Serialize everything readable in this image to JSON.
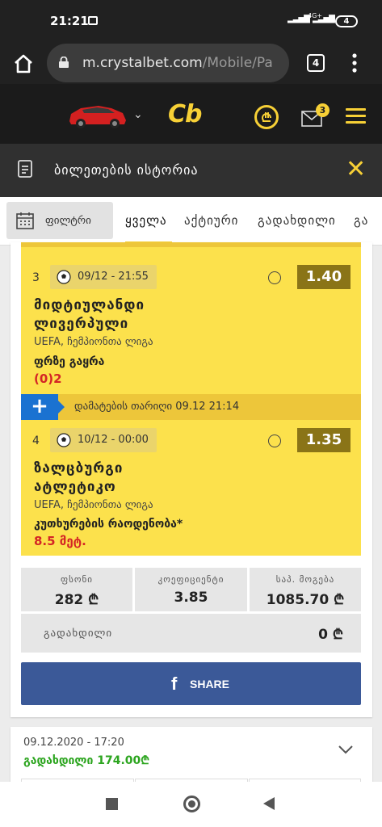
{
  "status_bar": {
    "time": "21:21",
    "network": "4G+",
    "battery": "4"
  },
  "browser": {
    "url_main": "m.crystalbet.com",
    "url_path": "/Mobile/Pa",
    "tab_count": "4"
  },
  "site_header": {
    "logo": "Cb",
    "mail_badge": "3"
  },
  "history_bar": {
    "title": "ბილეთების ისტორია"
  },
  "tabs": {
    "filter_label": "ფილტრი",
    "items": [
      "ყველა",
      "აქტიური",
      "გადახდილი",
      "გა"
    ]
  },
  "ticket": {
    "events": [
      {
        "add_label": "დამატების თარიღი 09.12 21:14",
        "number": "3",
        "datetime": "09/12 - 21:55",
        "odds": "1.40",
        "team1": "მიდტიულანდი",
        "team2": "ლივერპული",
        "league": "UEFA, ჩემპიონთა ლიგა",
        "market": "ფრზე გაყრა",
        "pick": "(0)2"
      },
      {
        "add_label": "დამატების თარიღი 09.12 21:14",
        "number": "4",
        "datetime": "10/12 - 00:00",
        "odds": "1.35",
        "team1": "ზალცბურგი",
        "team2": "ატლეტიკო",
        "league": "UEFA, ჩემპიონთა ლიგა",
        "market": "კუთხურების რაოდენობა*",
        "pick": "8.5 მეტ."
      }
    ],
    "stats": {
      "stake_label": "ფსონი",
      "stake_value": "282 ₾",
      "coef_label": "კოეფიციენტი",
      "coef_value": "3.85",
      "win_label": "საპ. მოგება",
      "win_value": "1085.70 ₾",
      "paid_label": "გადახდილი",
      "paid_value": "0 ₾"
    },
    "share_label": "SHARE"
  },
  "next_ticket": {
    "datetime": "09.12.2020 - 17:20",
    "status": "გადახდილი 174.00₾"
  },
  "colors": {
    "accent_yellow": "#f7d036",
    "event_bg": "#fce14c",
    "odds_bg": "#8a7417",
    "share_bg": "#3b5998",
    "pick_red": "#d42525",
    "paid_green": "#2ca51f"
  }
}
